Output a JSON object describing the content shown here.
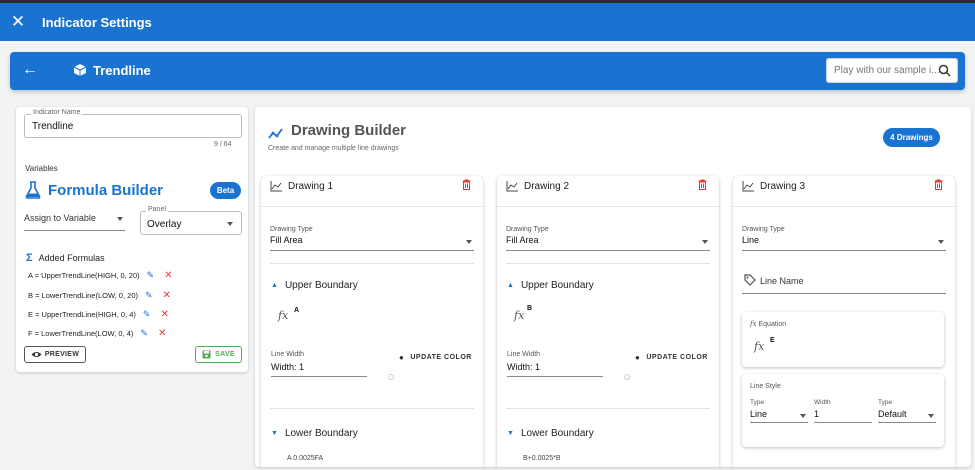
{
  "appbar": {
    "title": "Indicator Settings"
  },
  "header": {
    "title": "Trendline",
    "search_placeholder": "Play with our sample i..."
  },
  "left": {
    "name_label": "Indicator Name",
    "name_value": "Trendline",
    "counter": "9 / 64",
    "variables_label": "Variables",
    "formula_builder_title": "Formula Builder",
    "beta_badge": "Beta",
    "assign_placeholder": "Assign to Variable",
    "panel_label": "Panel",
    "panel_value": "Overlay",
    "added_formulas_label": "Added Formulas",
    "formulas": [
      "A = UpperTrendLine(HIGH, 0, 20)",
      "B = LowerTrendLine(LOW, 0, 20)",
      "E = UpperTrendLine(HIGH, 0, 4)",
      "F = LowerTrendLine(LOW, 0, 4)"
    ],
    "preview_label": "PREVIEW",
    "save_label": "SAVE"
  },
  "builder": {
    "title": "Drawing Builder",
    "subtitle": "Create and manage multiple line drawings",
    "badge": "4 Drawings",
    "cards": [
      {
        "name": "Drawing 1",
        "type_label": "Drawing Type",
        "type_value": "Fill Area",
        "upper_label": "Upper Boundary",
        "upper_var": "A",
        "line_width_label": "Line Width",
        "line_width_value": "Width: 1",
        "update_color": "UPDATE COLOR",
        "lower_label": "Lower Boundary",
        "cutoff": "A 0.0025FA"
      },
      {
        "name": "Drawing 2",
        "type_label": "Drawing Type",
        "type_value": "Fill Area",
        "upper_label": "Upper Boundary",
        "upper_var": "B",
        "line_width_label": "Line Width",
        "line_width_value": "Width: 1",
        "update_color": "UPDATE COLOR",
        "lower_label": "Lower Boundary",
        "cutoff": "B+0.0025*B"
      },
      {
        "name": "Drawing 3",
        "type_label": "Drawing Type",
        "type_value": "Line",
        "line_name_placeholder": "Line Name",
        "equation_label": "Equation",
        "equation_var": "E",
        "line_style_label": "Line Style",
        "style_type_label": "Type",
        "style_type_value": "Line",
        "style_width_label": "Width",
        "style_width_value": "1",
        "style_type2_label": "Type",
        "style_type2_value": "Default"
      }
    ]
  },
  "colors": {
    "primary": "#1a73d1",
    "danger": "#e53935",
    "success": "#4caf50",
    "background": "#f2f3f5"
  }
}
